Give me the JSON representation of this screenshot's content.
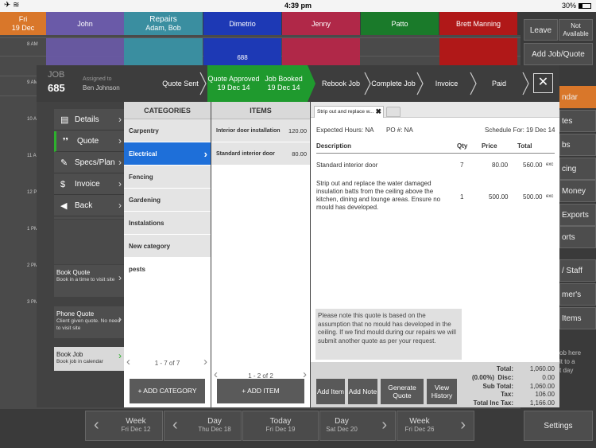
{
  "status": {
    "time": "4:39 pm",
    "battery": "30%",
    "left_icons": "✈ ≋"
  },
  "calendar": {
    "date_col": {
      "day": "Fri",
      "date": "19 Dec"
    },
    "columns": [
      {
        "name": "John",
        "sub": "",
        "color": "#6a5aa8"
      },
      {
        "name": "Repairs",
        "sub": "Adam, Bob",
        "color": "#3a8ea0"
      },
      {
        "name": "Dimetrio",
        "sub": "",
        "color": "#1d39b5"
      },
      {
        "name": "Jenny",
        "sub": "",
        "color": "#b02848"
      },
      {
        "name": "Patto",
        "sub": "",
        "color": "#1a7a2a"
      },
      {
        "name": "Brett Manning",
        "sub": "",
        "color": "#b01818"
      }
    ],
    "times": [
      "8 AM",
      "9 AM",
      "10 AM",
      "11 AM",
      "12 PM",
      "1 PM",
      "2 PM",
      "3 PM"
    ],
    "appt_label": "688",
    "letter_a": "A"
  },
  "right_buttons": {
    "leave": "Leave",
    "not_available": "Not Available",
    "add_job_quote": "Add Job/Quote",
    "calendar": "ndar",
    "notes": "tes",
    "jobs": "bs",
    "invoicing": "cing",
    "money": "Money",
    "exports": "Exports",
    "reports": "orts",
    "staff": "/ Staff",
    "customers": "mer's",
    "items": "Items",
    "hint": "ob here\nit to a\nt day",
    "settings": "Settings"
  },
  "bottom_nav": {
    "prev_week": {
      "label": "Week",
      "date": "Fri Dec 12"
    },
    "prev_day": {
      "label": "Day",
      "date": "Thu Dec 18"
    },
    "today": {
      "label": "Today",
      "date": "Fri Dec 19"
    },
    "next_day": {
      "label": "Day",
      "date": "Sat Dec 20"
    },
    "next_week": {
      "label": "Week",
      "date": "Fri Dec 26"
    }
  },
  "job": {
    "label": "JOB",
    "number": "685",
    "assigned_label": "Assigned to",
    "assigned_name": "Ben Johnson",
    "steps": [
      {
        "label": "Quote  Sent",
        "date": ""
      },
      {
        "label": "Quote Approved",
        "date": "19 Dec 14"
      },
      {
        "label": "Job Booked",
        "date": "19 Dec 14"
      },
      {
        "label": "Rebook Job",
        "date": ""
      },
      {
        "label": "Complete Job",
        "date": ""
      },
      {
        "label": "Invoice",
        "date": ""
      },
      {
        "label": "Paid",
        "date": ""
      }
    ],
    "close": "✕"
  },
  "tabs": [
    {
      "icon": "▤",
      "label": "Details"
    },
    {
      "icon": "❜❜",
      "label": "Quote"
    },
    {
      "icon": "✎",
      "label": "Specs/Plan"
    },
    {
      "icon": "$",
      "label": "Invoice"
    },
    {
      "icon": "◀",
      "label": "Back"
    }
  ],
  "side_actions": [
    {
      "title": "Book Quote",
      "sub": "Book in a time to visit site"
    },
    {
      "title": "Phone Quote",
      "sub": "Client given quote. No need to visit site"
    },
    {
      "title": "Book Job",
      "sub": "Book job in calendar"
    }
  ],
  "categories": {
    "header": "CATEGORIES",
    "items": [
      "Carpentry",
      "Electrical",
      "Fencing",
      "Gardening",
      "Instalations",
      "New category",
      "pests"
    ],
    "pager": "1 - 7 of 7",
    "add_button": "+ ADD CATEGORY"
  },
  "items": {
    "header": "ITEMS",
    "rows": [
      {
        "name": "Interior door installation",
        "price": "120.00"
      },
      {
        "name": "Standard interior door",
        "price": "80.00"
      }
    ],
    "pager": "1 - 2 of 2",
    "add_button": "+ ADD ITEM"
  },
  "quote": {
    "doc_tab": "Strip out and replace w...",
    "expected_hours": "Expected Hours: NA",
    "po": "PO #: NA",
    "schedule": "Schedule For: 19 Dec 14",
    "columns": {
      "description": "Description",
      "qty": "Qty",
      "price": "Price",
      "total": "Total"
    },
    "lines": [
      {
        "description": "Standard interior door",
        "qty": "7",
        "price": "80.00",
        "total": "560.00",
        "tax": "exc"
      },
      {
        "description": "Strip out and replace the water damaged insulation batts from the ceiling above the kitchen, dining and lounge areas. Ensure no mould has developed.",
        "qty": "1",
        "price": "500.00",
        "total": "500.00",
        "tax": "exc"
      }
    ],
    "note": "Please note this quote is based on the assumption that no mould has developed in the ceiling. If we find mould during our repairs we will submit another quote as per your request.",
    "buttons": {
      "add_item": "Add Item",
      "add_note": "Add Note",
      "generate_quote": "Generate Quote",
      "view_history": "View History"
    },
    "totals": {
      "total_label": "Total:",
      "total": "1,060.00",
      "disc_label": "(0.00%)  Disc:",
      "disc": "0.00",
      "sub_label": "Sub Total:",
      "sub": "1,060.00",
      "tax_label": "Tax:",
      "tax": "106.00",
      "inc_label": "Total Inc Tax:",
      "inc": "1,166.00"
    }
  }
}
